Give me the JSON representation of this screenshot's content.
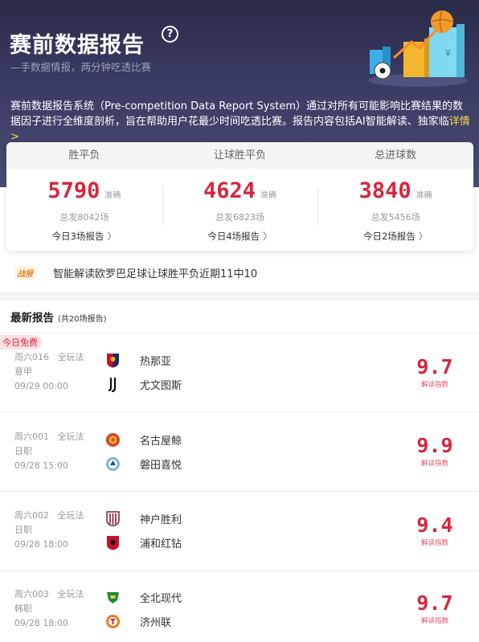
{
  "hero": {
    "title": "赛前数据报告",
    "help_icon": "question-circle-icon",
    "subtitle": "—手数据情报，两分钟吃透比赛",
    "description": "赛前数据报告系统（Pre-competition Data Report System）通过对所有可能影响比赛结果的数据因子进行全维度剖析，旨在帮助用户花最少时间吃透比赛。报告内容包括AI智能解读、独家临",
    "more_label": "详情>"
  },
  "stats": [
    {
      "header": "胜平负",
      "value": "5790",
      "tag": "准确",
      "total": "总发8042场",
      "link": "今日3场报告"
    },
    {
      "header": "让球胜平负",
      "value": "4624",
      "tag": "准确",
      "total": "总发6823场",
      "link": "今日4场报告"
    },
    {
      "header": "总进球数",
      "value": "3840",
      "tag": "准确",
      "total": "总发5456场",
      "link": "今日2场报告"
    }
  ],
  "news": {
    "badge": "战报",
    "text": "智能解读欧罗巴足球让球胜平负近期11中10"
  },
  "latest": {
    "title": "最新报告",
    "count": "(共20场报告)"
  },
  "matches": [
    {
      "badge": "今日免费",
      "code": "周六016",
      "play": "全玩法",
      "league": "意甲",
      "time": "09/29 00:00",
      "home": "热那亚",
      "away": "尤文图斯",
      "score": "9.7",
      "score_label": "解读指数"
    },
    {
      "code": "周六001",
      "play": "全玩法",
      "league": "日职",
      "time": "09/28 15:00",
      "home": "名古屋鲸",
      "away": "磐田喜悦",
      "score": "9.9",
      "score_label": "解读指数"
    },
    {
      "code": "周六002",
      "play": "全玩法",
      "league": "日职",
      "time": "09/28 18:00",
      "home": "神户胜利",
      "away": "浦和红钻",
      "score": "9.4",
      "score_label": "解读指数"
    },
    {
      "code": "周六003",
      "play": "全玩法",
      "league": "韩职",
      "time": "09/28 18:00",
      "home": "全北现代",
      "away": "济州联",
      "score": "9.7",
      "score_label": "解读指数"
    }
  ],
  "colors": {
    "accent": "#d7263d",
    "hero_bg": "#33355a",
    "highlight": "#ffd84a"
  }
}
